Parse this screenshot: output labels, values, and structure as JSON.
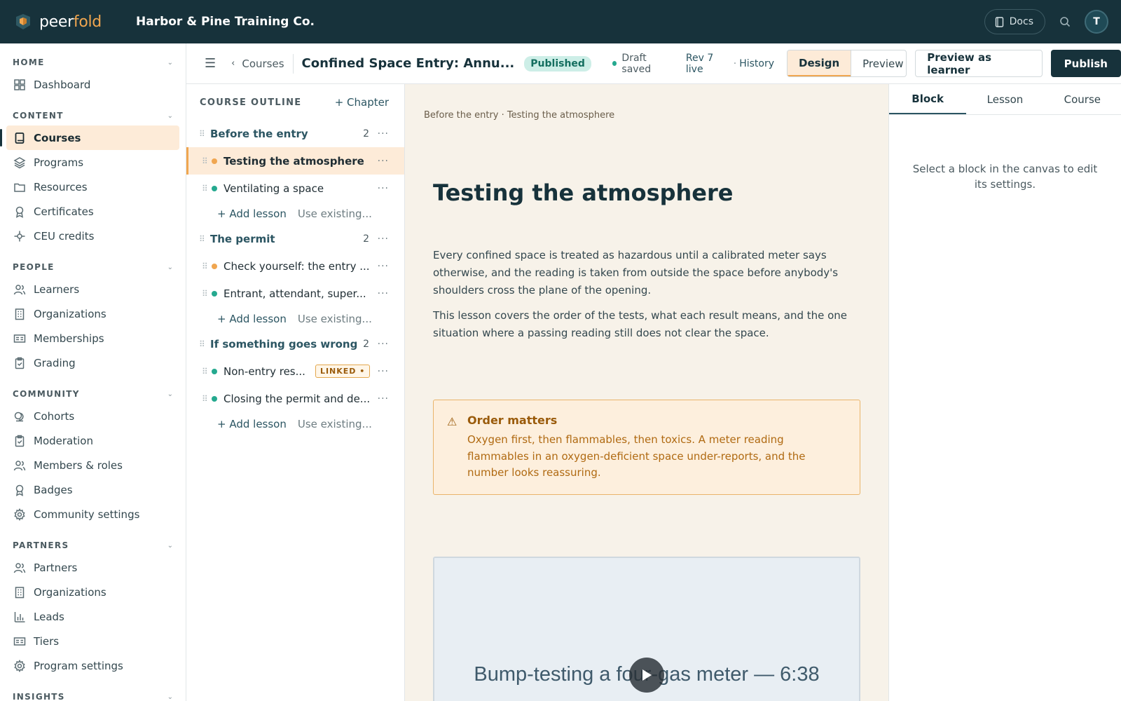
{
  "app": {
    "brand_part1": "peer",
    "brand_part2": "fold",
    "org": "Harbor & Pine Training Co.",
    "docs_label": "Docs",
    "avatar_initial": "T"
  },
  "nav": {
    "sections": [
      {
        "label": "HOME",
        "items": [
          {
            "label": "Dashboard",
            "icon": "dashboard-icon"
          }
        ]
      },
      {
        "label": "CONTENT",
        "items": [
          {
            "label": "Courses",
            "icon": "book-icon",
            "active": true
          },
          {
            "label": "Programs",
            "icon": "layers-icon"
          },
          {
            "label": "Resources",
            "icon": "folder-icon"
          },
          {
            "label": "Certificates",
            "icon": "award-icon"
          },
          {
            "label": "CEU credits",
            "icon": "ceu-icon"
          }
        ]
      },
      {
        "label": "PEOPLE",
        "items": [
          {
            "label": "Learners",
            "icon": "users-icon"
          },
          {
            "label": "Organizations",
            "icon": "building-icon"
          },
          {
            "label": "Memberships",
            "icon": "id-card-icon"
          },
          {
            "label": "Grading",
            "icon": "clipboard-icon"
          }
        ]
      },
      {
        "label": "COMMUNITY",
        "items": [
          {
            "label": "Cohorts",
            "icon": "cohorts-icon"
          },
          {
            "label": "Moderation",
            "icon": "clipboard-check-icon"
          },
          {
            "label": "Members & roles",
            "icon": "users-icon"
          },
          {
            "label": "Badges",
            "icon": "award-icon"
          },
          {
            "label": "Community settings",
            "icon": "gear-icon"
          }
        ]
      },
      {
        "label": "PARTNERS",
        "items": [
          {
            "label": "Partners",
            "icon": "users-icon"
          },
          {
            "label": "Organizations",
            "icon": "building-icon"
          },
          {
            "label": "Leads",
            "icon": "bar-chart-icon"
          },
          {
            "label": "Tiers",
            "icon": "id-card-icon"
          },
          {
            "label": "Program settings",
            "icon": "gear-icon"
          }
        ]
      },
      {
        "label": "INSIGHTS",
        "items": []
      }
    ]
  },
  "header": {
    "back_label": "Courses",
    "course_title": "Confined Space Entry: Annu...",
    "status_badge": "Published",
    "draft_status": "Draft saved",
    "revision": "Rev 7 live",
    "separator": "·",
    "history": "History",
    "design": "Design",
    "preview": "Preview",
    "preview_learner": "Preview as learner",
    "publish": "Publish"
  },
  "outline": {
    "title": "COURSE OUTLINE",
    "add_chapter": "+ Chapter",
    "add_lesson": "+ Add lesson",
    "use_existing": "Use existing...",
    "chapters": [
      {
        "title": "Before the entry",
        "count": "2",
        "lessons": [
          {
            "name": "Testing the atmosphere",
            "status": "draft",
            "active": true
          },
          {
            "name": "Ventilating a space",
            "status": "published"
          }
        ]
      },
      {
        "title": "The permit",
        "count": "2",
        "lessons": [
          {
            "name": "Check yourself: the entry ...",
            "status": "draft"
          },
          {
            "name": "Entrant, attendant, super...",
            "status": "published"
          }
        ]
      },
      {
        "title": "If something goes wrong",
        "count": "2",
        "lessons": [
          {
            "name": "Non-entry res...",
            "status": "published",
            "badge": "LINKED •"
          },
          {
            "name": "Closing the permit and de...",
            "status": "published"
          }
        ]
      }
    ]
  },
  "canvas": {
    "breadcrumb": "Before the entry · Testing the atmosphere",
    "title": "Testing the atmosphere",
    "para1": "Every confined space is treated as hazardous until a calibrated meter says otherwise, and the reading is taken from outside the space before anybody's shoulders cross the plane of the opening.",
    "para2": "This lesson covers the order of the tests, what each result means, and the one situation where a passing reading still does not clear the space.",
    "callout_title": "Order matters",
    "callout_body": "Oxygen first, then flammables, then toxics. A meter reading flammables in an oxygen-deficient space under-reports, and the number looks reassuring.",
    "video_caption": "Bump-testing a four-gas meter — 6:38"
  },
  "inspector": {
    "tabs": [
      "Block",
      "Lesson",
      "Course"
    ],
    "hint": "Select a block in the canvas to edit its settings."
  },
  "colors": {
    "topbar": "#17323b",
    "accent_orange": "#f0a650",
    "draft_dot": "#f0a650",
    "published_dot": "#25a98f",
    "canvas_bg": "#f7f2e9"
  }
}
